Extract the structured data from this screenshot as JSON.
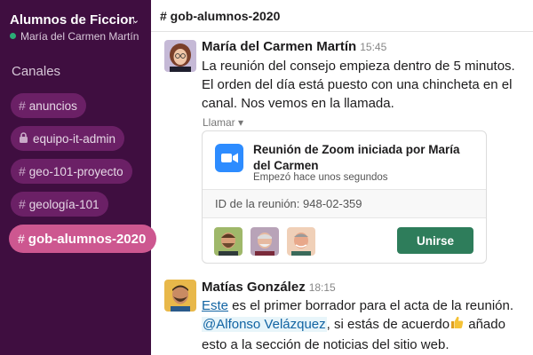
{
  "workspace": {
    "name": "Alumnos de Ficcion…",
    "user": "María del Carmen Martín"
  },
  "sidebar": {
    "section_title": "Canales",
    "channels": [
      {
        "label": "anuncios",
        "icon": "hash"
      },
      {
        "label": "equipo-it-admin",
        "icon": "lock"
      },
      {
        "label": "geo-101-proyecto",
        "icon": "hash"
      },
      {
        "label": "geología-101",
        "icon": "hash"
      },
      {
        "label": "gob-alumnos-2020",
        "icon": "hash",
        "active": true
      }
    ]
  },
  "header": {
    "channel_title": "# gob-alumnos-2020"
  },
  "messages": [
    {
      "author": "María del Carmen Martín",
      "time": "15:45",
      "text_lines": [
        "La reunión del consejo empieza dentro de 5 minutos.",
        "El orden del día está puesto con una chincheta en el",
        "canal. Nos vemos en la llamada."
      ],
      "call_label": "Llamar ▾",
      "call_card": {
        "title": "Reunión de Zoom iniciada por María del Carmen",
        "subtitle": "Empezó hace unos segundos",
        "meeting_id": "ID de la reunión: 948-02-359",
        "join_label": "Unirse"
      }
    },
    {
      "author": "Matías González",
      "time": "18:15",
      "line1_link": "Este",
      "line1_rest": " es el primer borrador para el acta de la reunión.",
      "line2_mention": "@Alfonso Velázquez",
      "line2_rest": ", si estás de acuerdo",
      "line2_end": " añado",
      "line3": "esto a la sección de noticias del sitio web."
    }
  ],
  "colors": {
    "sidebar_bg": "#3f0e40",
    "active_channel": "#cd5790",
    "channel_pill": "#6b2066",
    "join_button": "#2e7d5b",
    "zoom_blue": "#2d8cff",
    "link": "#1264a3"
  }
}
